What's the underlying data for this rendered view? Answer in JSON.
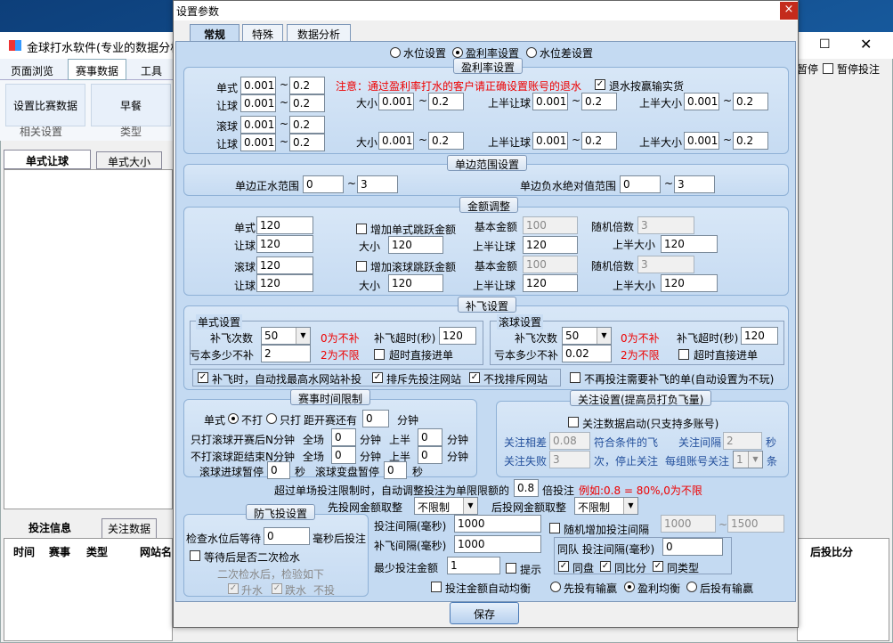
{
  "bgwin": {
    "title": "金球打水软件(专业的数据分析)",
    "menu": [
      "页面浏览",
      "赛事数据",
      "工具"
    ],
    "ribbon_btn1": "设置比赛数据",
    "ribbon_btn2": "早餐",
    "ribbon_grp1": "相关设置",
    "ribbon_grp2": "类型",
    "tabs_a": [
      "单式让球",
      "单式大小"
    ],
    "tabs_b": [
      "投注信息",
      "关注数据"
    ],
    "cols": [
      "时间",
      "赛事",
      "类型",
      "网站名"
    ],
    "col_right": "后投比分",
    "right_items": [
      "暂停",
      "暂停投注"
    ]
  },
  "dialog": {
    "title": "设置参数",
    "close": "×",
    "tabs": [
      "常规",
      "特殊",
      "数据分析"
    ],
    "mode_radios": [
      "水位设置",
      "盈利率设置",
      "水位差设置"
    ],
    "save": "保存"
  },
  "profit": {
    "title": "盈利率设置",
    "notice": "注意：通过盈利率打水的客户请正确设置账号的退水",
    "chk_label": "退水按赢输实货",
    "l_single": "单式",
    "l_rq": "让球",
    "l_gun": "滚球",
    "l_rq2": "让球",
    "l_dx": "大小",
    "l_sbrq": "上半让球",
    "l_sbdx": "上半大小",
    "v_min": "0.001",
    "v_max": "0.2",
    "tilde": "~"
  },
  "range": {
    "title": "单边范围设置",
    "pos_label": "单边正水范围",
    "pos_min": "0",
    "pos_max": "3",
    "neg_label": "单边负水绝对值范围",
    "neg_min": "0",
    "neg_max": "3",
    "tilde": "~"
  },
  "amount": {
    "title": "金额调整",
    "single": "单式",
    "rq": "让球",
    "gun": "滚球",
    "rq2": "让球",
    "val": "120",
    "jump1": "增加单式跳跃金额",
    "jump2": "增加滚球跳跃金额",
    "base": "基本金额",
    "base_val": "100",
    "rand": "随机倍数",
    "rand_val": "3",
    "dx": "大小",
    "sbrq": "上半让球",
    "sbdx": "上半大小"
  },
  "bufei": {
    "title": "补飞设置",
    "single_title": "单式设置",
    "gun_title": "滚球设置",
    "times_label": "补飞次数",
    "times_val": "50",
    "zero_note": "0为不补",
    "timeout_label": "补飞超时(秒)",
    "timeout_val": "120",
    "loss_label": "亏本多少不补",
    "loss_val1": "2",
    "loss_val2": "0.02",
    "two_note": "2为不限",
    "direct": "超时直接进单",
    "opt1": "补飞时，自动找最高水网站补投",
    "opt2": "排斥先投注网站",
    "opt3": "不找排斥网站",
    "opt4": "不再投注需要补飞的单(自动设置为不玩)"
  },
  "time": {
    "title": "赛事时间限制",
    "single": "单式",
    "not": "不打",
    "only": "只打",
    "dist": "距开赛还有",
    "dist_val": "0",
    "min": "分钟",
    "r1": "只打滚球开赛后N分钟",
    "r2": "不打滚球距结束N分钟",
    "full": "全场",
    "half": "上半",
    "v": "0",
    "gunpause": "滚球进球暂停",
    "sec": "秒",
    "gunchange": "滚球变盘暂停"
  },
  "focus": {
    "title": "关注设置(提高员打负飞量)",
    "enable": "关注数据启动(只支持多账号)",
    "diff": "关注相差",
    "diff_val": "0.08",
    "match": "符合条件的飞",
    "interval": "关注间隔",
    "interval_val": "2",
    "sec": "秒",
    "fail": "关注失败",
    "fail_val": "3",
    "stop": "次，停止关注",
    "per": "每组账号关注",
    "per_val": "1",
    "tiao": "条"
  },
  "over": {
    "text": "超过单场投注限制时，自动调整投注为单限限额的",
    "val": "0.8",
    "mult": "倍投注",
    "example": "例如:0.8 = 80%,0为不限",
    "first_label": "先投网金额取整",
    "first_val": "不限制",
    "after_label": "后投网金额取整",
    "after_val": "不限制"
  },
  "anti": {
    "title": "防飞投设置",
    "check_wait": "检查水位后等待",
    "wait_val": "0",
    "wait_unit": "毫秒后投注",
    "second": "等待后是否二次检水",
    "after2": "二次检水后，检验如下",
    "up": "升水",
    "down": "跌水",
    "notbet": "不投"
  },
  "inter": {
    "bet_label": "投注间隔(毫秒)",
    "bet_val": "1000",
    "fly_label": "补飞间隔(毫秒)",
    "fly_val": "1000",
    "min_label": "最少投注金额",
    "min_val": "1",
    "tip": "提示",
    "rand": "随机增加投注间隔",
    "rmin": "1000",
    "rmax": "1500",
    "team": "同队 投注间隔(毫秒)",
    "team_val": "0",
    "same1": "同盘",
    "same2": "同比分",
    "same3": "同类型",
    "auto": "投注金额自动均衡",
    "r1": "先投有输赢",
    "r2": "盈利均衡",
    "r3": "后投有输赢"
  }
}
